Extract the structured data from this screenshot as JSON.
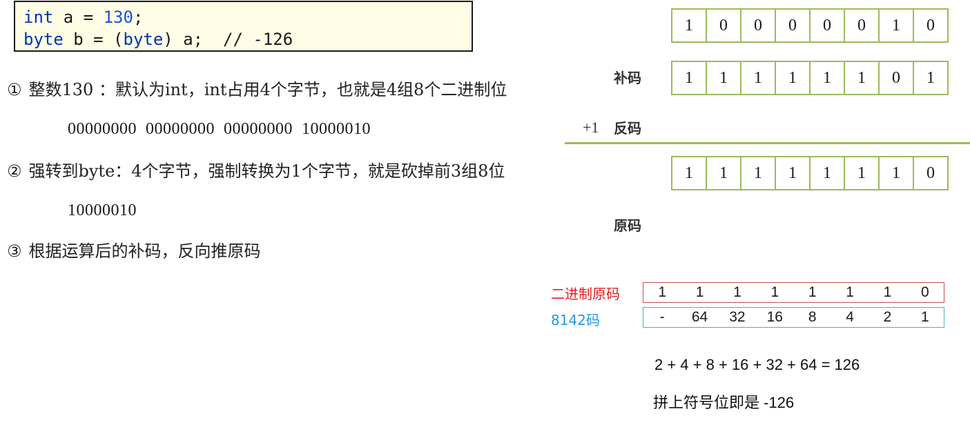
{
  "code": {
    "line1": {
      "kw": "int",
      "mid": " a = ",
      "num": "130",
      "end": ";"
    },
    "line2": {
      "kw1": "byte",
      "mid1": " b = (",
      "kw2": "byte",
      "end": ") a;  // -126"
    }
  },
  "steps": [
    {
      "marker": "①",
      "text": "整数130 ：默认为int，int占用4个字节，也就是4组8个二进制位"
    },
    {
      "marker": "②",
      "text": "强转到byte：4个字节，强制转换为1个字节，就是砍掉前3组8位"
    },
    {
      "marker": "③",
      "text": "根据运算后的补码，反向推原码"
    }
  ],
  "binary": {
    "full": "00000000  00000000  00000000  10000010",
    "byte": "10000010"
  },
  "bitrows": [
    {
      "bits": [
        "1",
        "0",
        "0",
        "0",
        "0",
        "0",
        "1",
        "0"
      ]
    },
    {
      "bits": [
        "1",
        "1",
        "1",
        "1",
        "1",
        "1",
        "0",
        "1"
      ]
    },
    {
      "bits": [
        "1",
        "1",
        "1",
        "1",
        "1",
        "1",
        "1",
        "0"
      ]
    }
  ],
  "labels": {
    "complement": "补码",
    "plus_one": "+1",
    "ones_complement": "反码",
    "original": "原码"
  },
  "table": {
    "red_label": "二进制原码",
    "blue_label": "8142码",
    "red_cells": [
      "1",
      "1",
      "1",
      "1",
      "1",
      "1",
      "1",
      "0"
    ],
    "blue_cells": [
      "-",
      "64",
      "32",
      "16",
      "8",
      "4",
      "2",
      "1"
    ]
  },
  "calc": {
    "sum": "2 + 4 + 8 + 16 + 32 + 64 = 126",
    "result": "拼上符号位即是 -126"
  }
}
